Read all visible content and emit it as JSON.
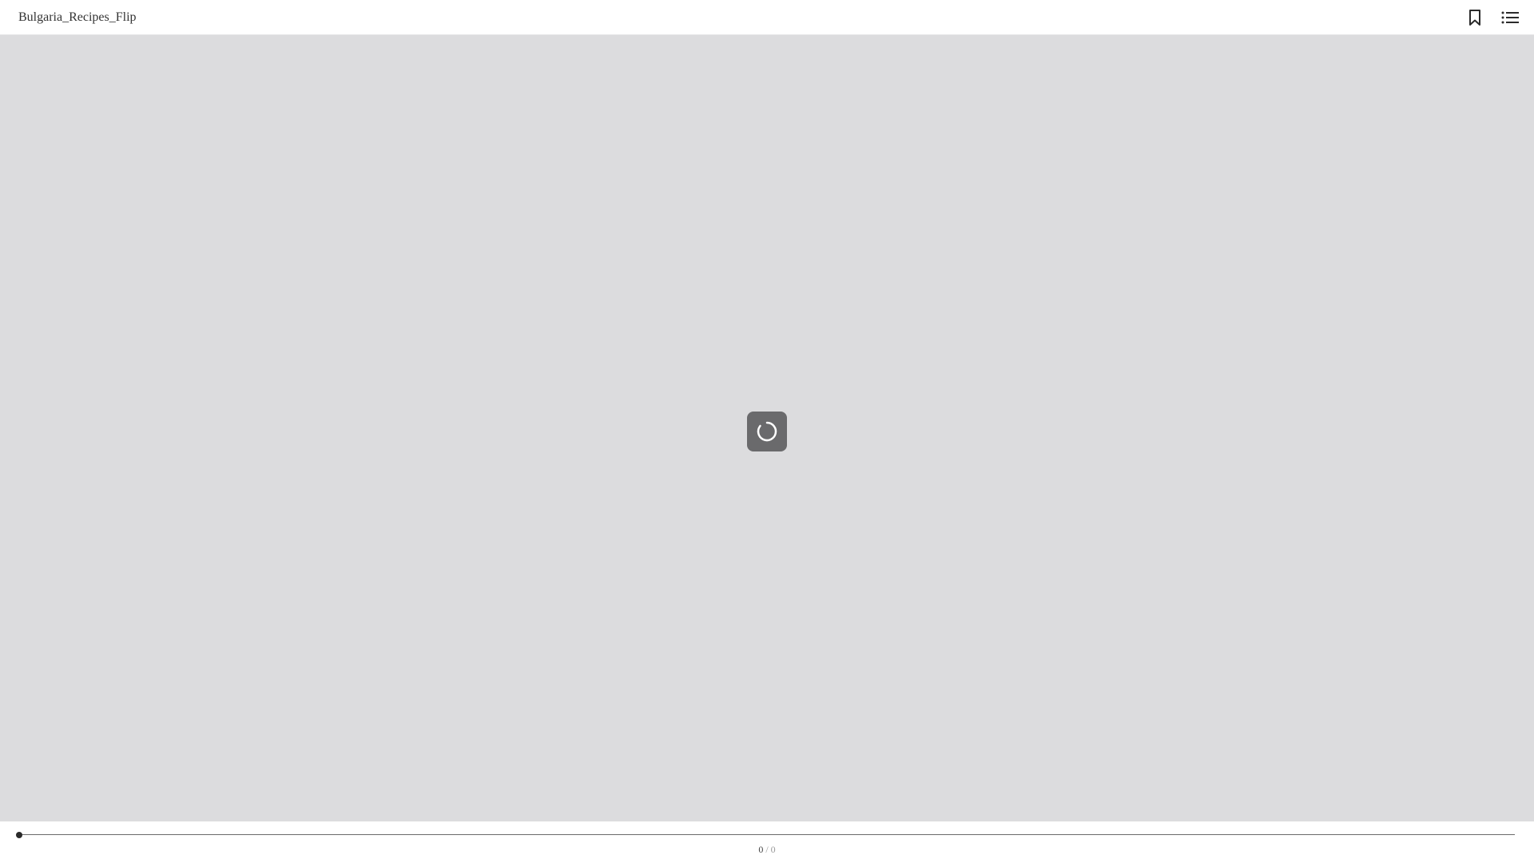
{
  "header": {
    "title": "Bulgaria_Recipes_Flip",
    "bookmark_icon": "bookmark-icon",
    "toc_icon": "list-icon"
  },
  "viewer": {
    "state": "loading",
    "spinner_icon": "loading-spinner-icon"
  },
  "footer": {
    "progress": 0,
    "current_page": "0",
    "separator": "/",
    "total_pages": "0"
  },
  "colors": {
    "viewer_background": "#dcdcde",
    "spinner_background": "#6a6a6c",
    "text": "#333333"
  }
}
